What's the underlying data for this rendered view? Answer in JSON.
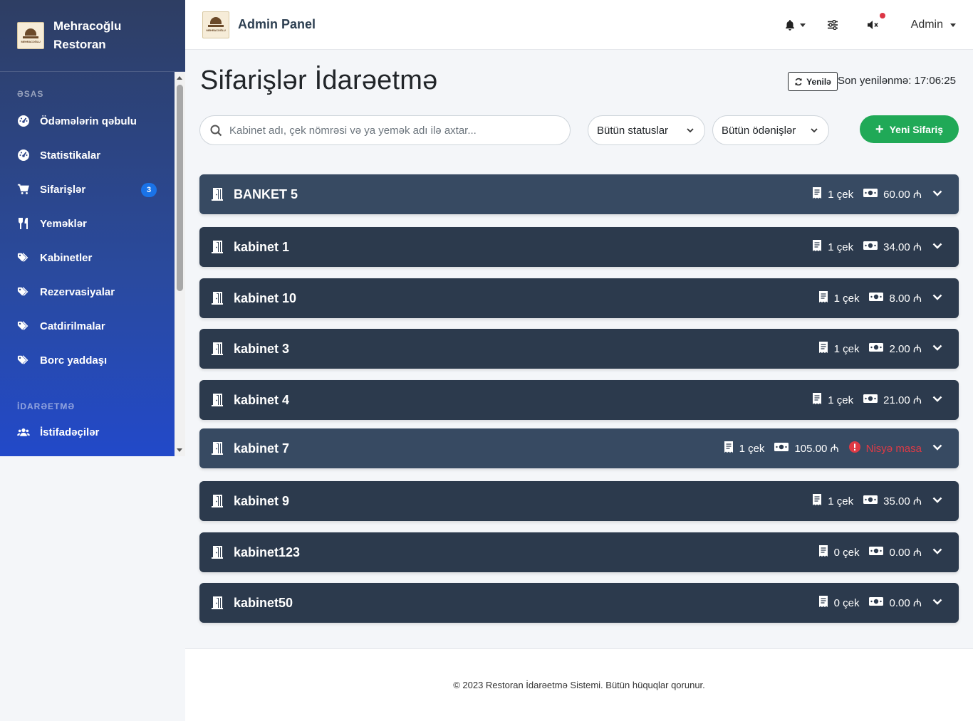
{
  "brand": {
    "name": "Mehracoğlu Restoran",
    "logo_text": "MEHRACOĞLU"
  },
  "sidebar": {
    "sections": [
      {
        "title": "ƏSAS",
        "items": [
          {
            "label": "Ödəmələrin qəbulu",
            "icon": "tachometer-icon"
          },
          {
            "label": "Statistikalar",
            "icon": "tachometer-icon"
          },
          {
            "label": "Sifarişlər",
            "icon": "cart-icon",
            "badge": "3"
          },
          {
            "label": "Yeməklər",
            "icon": "utensils-icon"
          },
          {
            "label": "Kabinetler",
            "icon": "tag-icon"
          },
          {
            "label": "Rezervasiyalar",
            "icon": "tag-icon"
          },
          {
            "label": "Catdirilmalar",
            "icon": "tag-icon"
          },
          {
            "label": "Borc yaddaşı",
            "icon": "tag-icon"
          }
        ]
      },
      {
        "title": "İDARƏETMƏ",
        "items": [
          {
            "label": "İstifadəçilər",
            "icon": "users-icon"
          }
        ]
      }
    ]
  },
  "topbar": {
    "title": "Admin Panel",
    "user": "Admin"
  },
  "main": {
    "title": "Sifarişlər İdarəetmə",
    "refresh_label": "Yenilə",
    "last_updated": "Son yenilənmə: 17:06:25",
    "search_placeholder": "Kabinet adı, çek nömrəsi və ya yemək adı ilə axtar...",
    "status_filter": "Bütün statuslar",
    "payment_filter": "Bütün ödənişlər",
    "new_order_label": "Yeni Sifariş"
  },
  "cabinets": [
    {
      "name": "BANKET 5",
      "checks": "1 çek",
      "amount": "60.00 ₼",
      "light": true
    },
    {
      "name": "kabinet 1",
      "checks": "1 çek",
      "amount": "34.00 ₼"
    },
    {
      "name": "kabinet 10",
      "checks": "1 çek",
      "amount": "8.00 ₼"
    },
    {
      "name": "kabinet 3",
      "checks": "1 çek",
      "amount": "2.00 ₼"
    },
    {
      "name": "kabinet 4",
      "checks": "1 çek",
      "amount": "21.00 ₼"
    },
    {
      "name": "kabinet 7",
      "checks": "1 çek",
      "amount": "105.00 ₼",
      "debt": "Nisyə masa",
      "light": true
    },
    {
      "name": "kabinet 9",
      "checks": "1 çek",
      "amount": "35.00 ₼"
    },
    {
      "name": "kabinet123",
      "checks": "0 çek",
      "amount": "0.00 ₼"
    },
    {
      "name": "kabinet50",
      "checks": "0 çek",
      "amount": "0.00 ₼"
    }
  ],
  "footer": {
    "text": "© 2023 Restoran İdarəetmə Sistemi. Bütün hüquqlar qorunur."
  }
}
